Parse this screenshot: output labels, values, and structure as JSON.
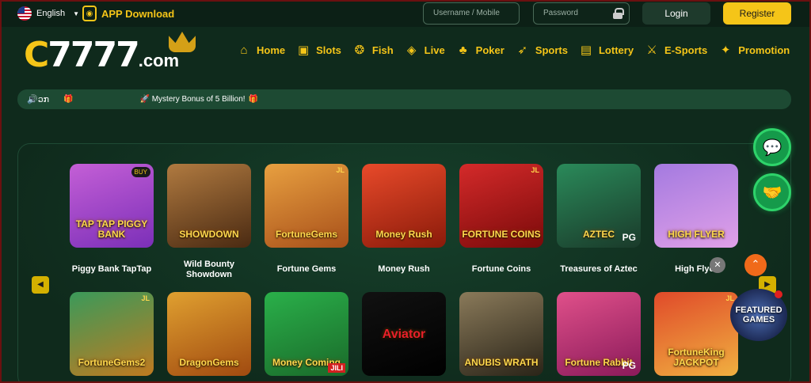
{
  "topbar": {
    "language": "English",
    "app_download": "APP Download",
    "username_placeholder": "Username / Mobile",
    "password_placeholder": "Password",
    "login": "Login",
    "register": "Register"
  },
  "logo": {
    "main": "7777",
    "domain": ".com",
    "prefix": "C"
  },
  "nav": [
    {
      "label": "Home",
      "icon": "home-icon",
      "glyph": "⌂"
    },
    {
      "label": "Slots",
      "icon": "slots-icon",
      "glyph": "▣"
    },
    {
      "label": "Fish",
      "icon": "fish-icon",
      "glyph": "❂"
    },
    {
      "label": "Live",
      "icon": "live-icon",
      "glyph": "◈"
    },
    {
      "label": "Poker",
      "icon": "poker-icon",
      "glyph": "♣"
    },
    {
      "label": "Sports",
      "icon": "sports-icon",
      "glyph": "➶"
    },
    {
      "label": "Lottery",
      "icon": "lottery-icon",
      "glyph": "▤"
    },
    {
      "label": "E-Sports",
      "icon": "esports-icon",
      "glyph": "⚔"
    },
    {
      "label": "Promotion",
      "icon": "gift-icon",
      "glyph": "✦"
    }
  ],
  "marquee": {
    "speaker": "🔊ວກ",
    "message": "Mystery Bonus of 5 Billion!"
  },
  "games_row1": [
    {
      "name": "Piggy Bank TapTap",
      "art": "TAP TAP PIGGY BANK",
      "badge": "BUY",
      "bg": "linear-gradient(160deg,#c45fd6,#7b2fb8)"
    },
    {
      "name": "Wild Bounty Showdown",
      "art": "SHOWDOWN",
      "bg": "linear-gradient(160deg,#b07a40,#4a2a12)"
    },
    {
      "name": "Fortune Gems",
      "art": "FortuneGems",
      "badge": "JL",
      "bg": "linear-gradient(160deg,#e8a040,#a8501a)"
    },
    {
      "name": "Money Rush",
      "art": "Money Rush",
      "bg": "linear-gradient(160deg,#e84a2a,#8a1a0a)"
    },
    {
      "name": "Fortune Coins",
      "art": "FORTUNE COINS",
      "badge": "JL",
      "bg": "linear-gradient(160deg,#d42a2a,#7a0a0a)"
    },
    {
      "name": "Treasures of Aztec",
      "art": "AZTEC",
      "badge": "PG",
      "bg": "linear-gradient(160deg,#2a8a5a,#1a3a2a)"
    },
    {
      "name": "High Flyer",
      "art": "HIGH FLYER",
      "bg": "linear-gradient(160deg,#a47ae0,#e0a0e8)"
    }
  ],
  "games_row2": [
    {
      "art": "FortuneGems2",
      "badge": "JL",
      "bg": "linear-gradient(160deg,#3a9a5a,#c07a20)"
    },
    {
      "art": "DragonGems",
      "bg": "linear-gradient(160deg,#e0a030,#a04a10)"
    },
    {
      "art": "Money Coming",
      "badge": "JILI",
      "bg": "linear-gradient(160deg,#2ab04a,#1a6a2a)"
    },
    {
      "art": "Aviator",
      "bg": "linear-gradient(160deg,#111,#000)"
    },
    {
      "art": "ANUBIS WRATH",
      "bg": "linear-gradient(160deg,#8a7a5a,#2a2418)"
    },
    {
      "art": "Fortune Rabbit",
      "badge": "PG",
      "bg": "linear-gradient(160deg,#e0508a,#8a1a5a)"
    },
    {
      "art": "FortuneKing JACKPOT",
      "badge": "JL",
      "bg": "linear-gradient(160deg,#e04a2a,#f0b040)"
    }
  ],
  "featured": "FEATURED GAMES"
}
